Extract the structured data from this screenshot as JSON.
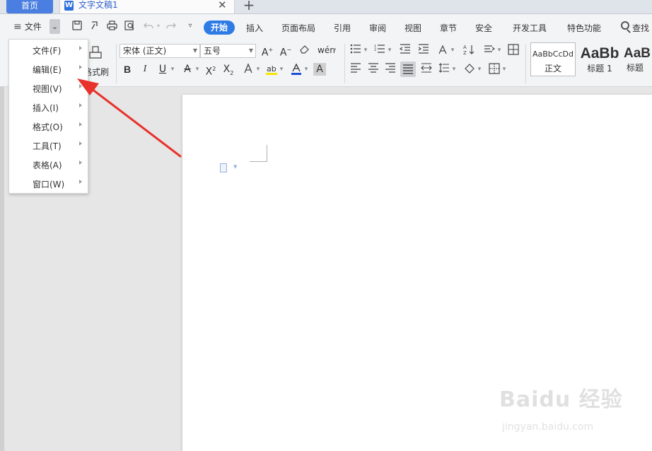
{
  "tabs": {
    "home_label": "首页",
    "doc_icon": "W",
    "doc_title": "文字文稿1",
    "close_glyph": "✕",
    "add_glyph": "+"
  },
  "menubar": {
    "file_label": "文件",
    "hamburger_glyph": "≡",
    "dropdown_glyph": "⌄",
    "ribbon_tabs": [
      "开始",
      "插入",
      "页面布局",
      "引用",
      "审阅",
      "视图",
      "章节",
      "安全",
      "开发工具",
      "特色功能"
    ],
    "search_label": "查找"
  },
  "ribbon": {
    "format_painter_label": "格式刷",
    "font_name": "宋体 (正文)",
    "font_size": "五号",
    "styles": [
      {
        "sample": "AaBbCcDd",
        "name": "正文"
      },
      {
        "sample": "AaBb",
        "name": "标题 1"
      },
      {
        "sample": "AaB",
        "name": "标题"
      }
    ]
  },
  "file_menu": {
    "items": [
      "文件(F)",
      "编辑(E)",
      "视图(V)",
      "插入(I)",
      "格式(O)",
      "工具(T)",
      "表格(A)",
      "窗口(W)"
    ]
  },
  "watermark": {
    "brand": "Baidu 经验",
    "url": "jingyan.baidu.com"
  },
  "colors": {
    "accent": "#2f7be5",
    "home_tab": "#4a7ee0",
    "arrow": "#e8322b"
  }
}
